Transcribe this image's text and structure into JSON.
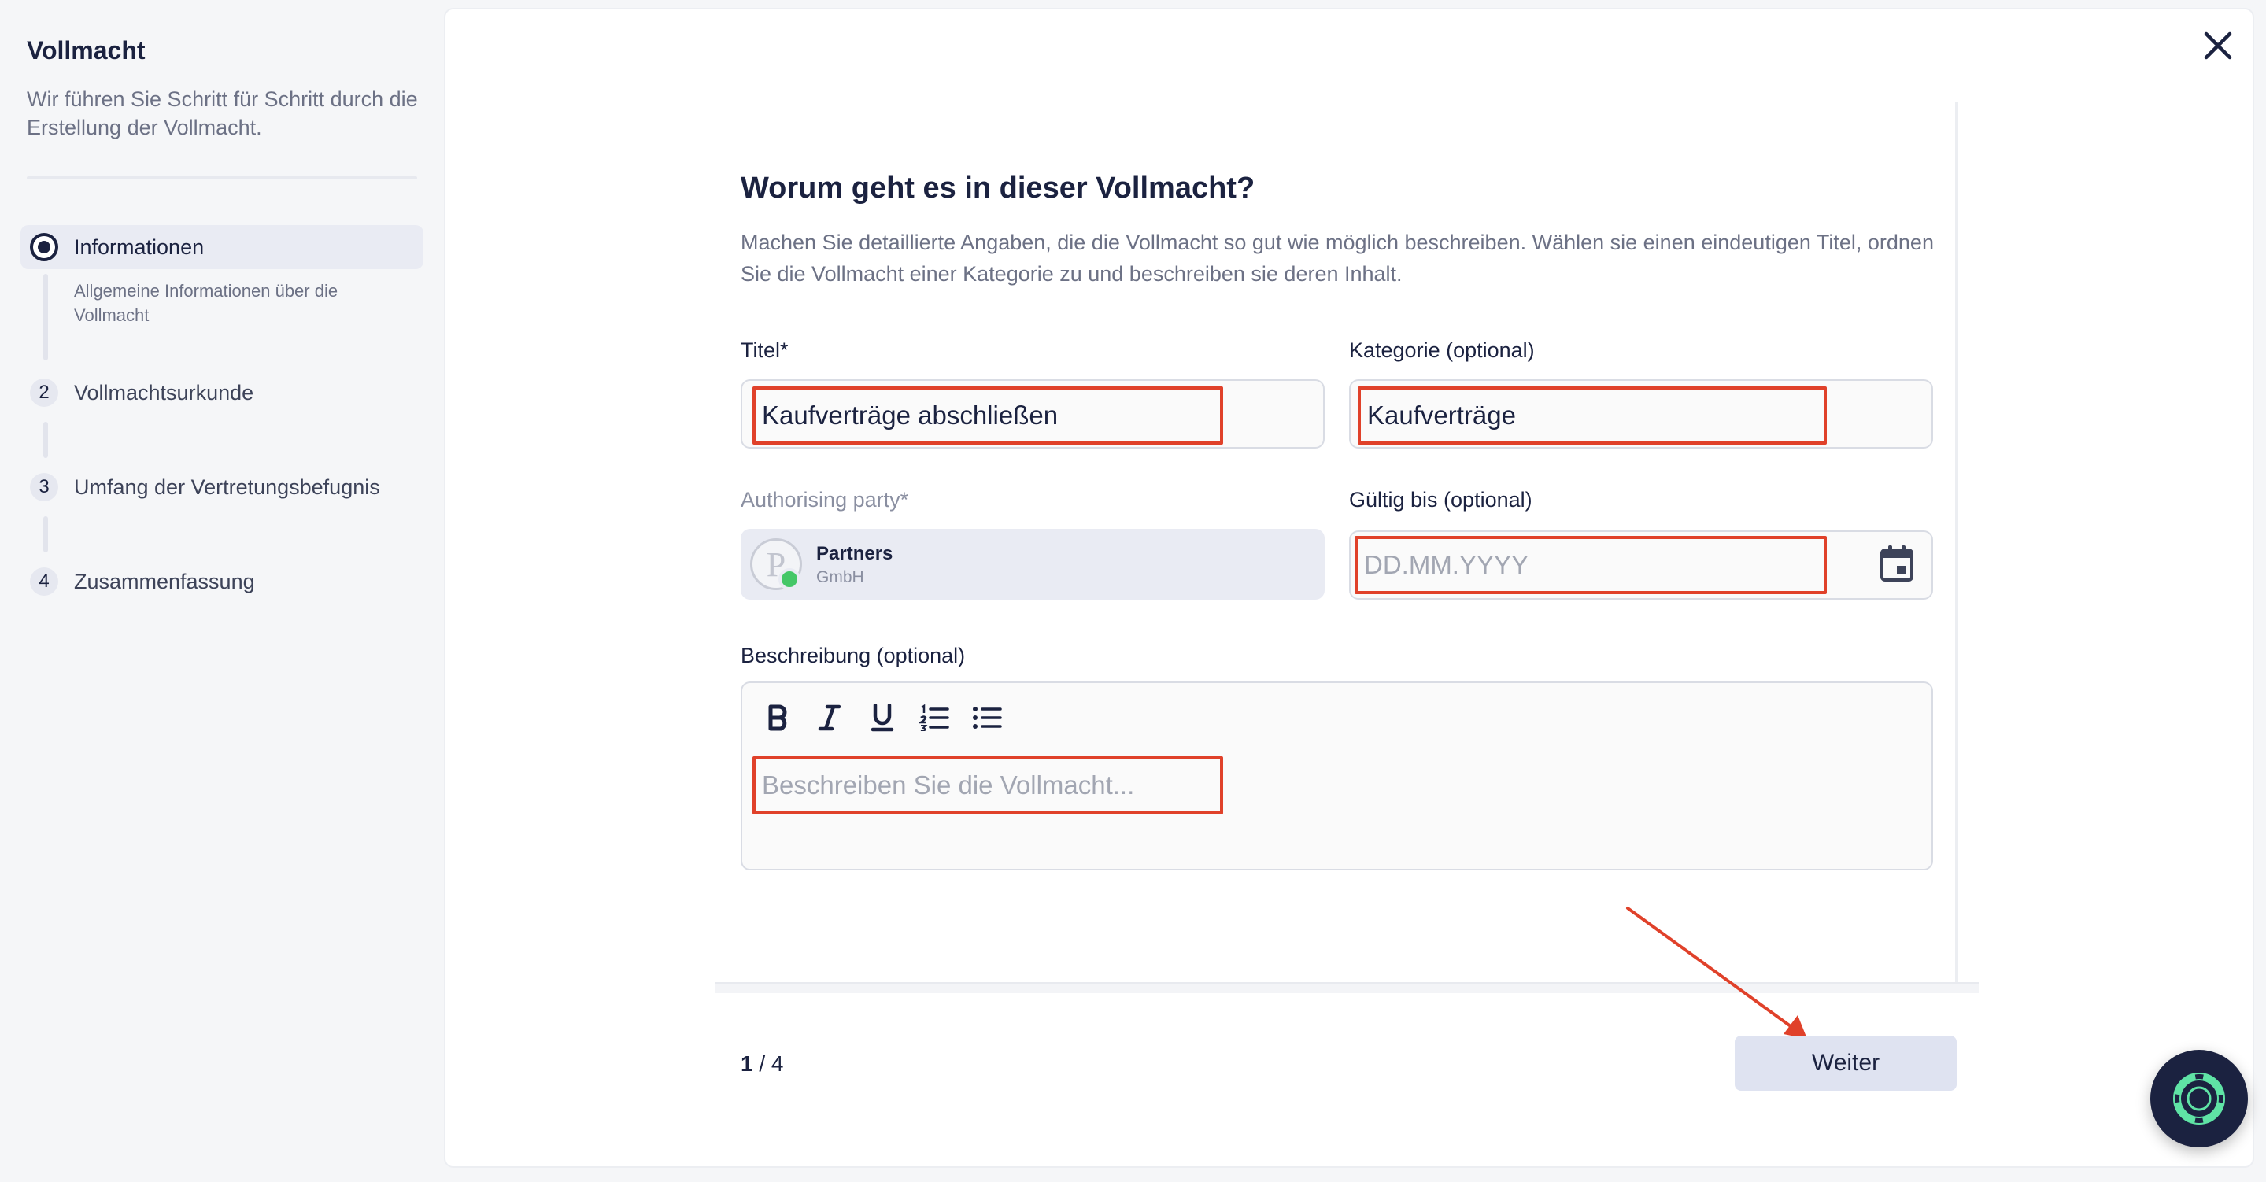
{
  "sidebar": {
    "title": "Vollmacht",
    "subtitle": "Wir führen Sie Schritt für Schritt durch die Erstellung der Vollmacht.",
    "steps": [
      {
        "marker": "",
        "label": "Informationen",
        "description": "Allgemeine Informationen über die Vollmacht",
        "active": true
      },
      {
        "marker": "2",
        "label": "Vollmachtsurkunde"
      },
      {
        "marker": "3",
        "label": "Umfang der Vertretungsbefugnis"
      },
      {
        "marker": "4",
        "label": "Zusammenfassung"
      }
    ]
  },
  "form": {
    "heading": "Worum geht es in dieser Vollmacht?",
    "description": "Machen Sie detaillierte Angaben, die die Vollmacht so gut wie möglich beschreiben. Wählen sie einen eindeutigen Titel, ordnen Sie die Vollmacht einer Kategorie zu und beschreiben sie deren Inhalt.",
    "title_label": "Titel*",
    "title_value": "Kaufverträge abschließen",
    "category_label": "Kategorie (optional)",
    "category_value": "Kaufverträge",
    "party_label": "Authorising party*",
    "party_avatar": "P",
    "party_name": "Partners",
    "party_sub": "GmbH",
    "valid_label": "Gültig bis (optional)",
    "valid_placeholder": "DD.MM.YYYY",
    "desc_label": "Beschreibung (optional)",
    "desc_placeholder": "Beschreiben Sie die Vollmacht...",
    "toolbar": [
      "bold-icon",
      "italic-icon",
      "underline-icon",
      "ordered-list-icon",
      "bullet-list-icon"
    ]
  },
  "footer": {
    "page_current": "1",
    "page_total": " / 4",
    "next_label": "Weiter"
  },
  "icons": {
    "close": "close-icon",
    "calendar": "calendar-icon",
    "help": "lifebuoy-icon"
  },
  "colors": {
    "accent_dark": "#1b2240",
    "highlight": "#e0412a",
    "online": "#44c767",
    "button_bg": "#dfe3f1"
  }
}
